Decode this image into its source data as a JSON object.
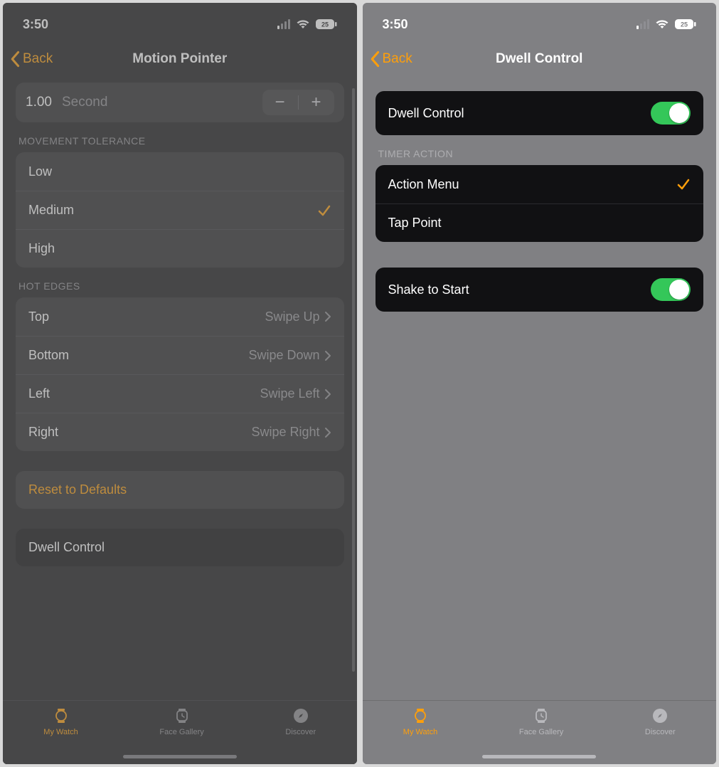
{
  "status": {
    "time": "3:50",
    "battery": "25"
  },
  "left": {
    "back": "Back",
    "title": "Motion Pointer",
    "stepper": {
      "value": "1.00",
      "unit": "Second"
    },
    "movement_header": "MOVEMENT TOLERANCE",
    "movement": {
      "low": "Low",
      "medium": "Medium",
      "high": "High",
      "selected": "Medium"
    },
    "hot_header": "HOT EDGES",
    "hot": [
      {
        "label": "Top",
        "value": "Swipe Up"
      },
      {
        "label": "Bottom",
        "value": "Swipe Down"
      },
      {
        "label": "Left",
        "value": "Swipe Left"
      },
      {
        "label": "Right",
        "value": "Swipe Right"
      }
    ],
    "reset": "Reset to Defaults",
    "dwell_link": "Dwell Control"
  },
  "right": {
    "back": "Back",
    "title": "Dwell Control",
    "dwell_toggle_label": "Dwell Control",
    "timer_header": "TIMER ACTION",
    "timer": {
      "action_menu": "Action Menu",
      "tap_point": "Tap Point",
      "selected": "Action Menu"
    },
    "shake_label": "Shake to Start"
  },
  "tabs": {
    "my_watch": "My Watch",
    "face_gallery": "Face Gallery",
    "discover": "Discover"
  }
}
